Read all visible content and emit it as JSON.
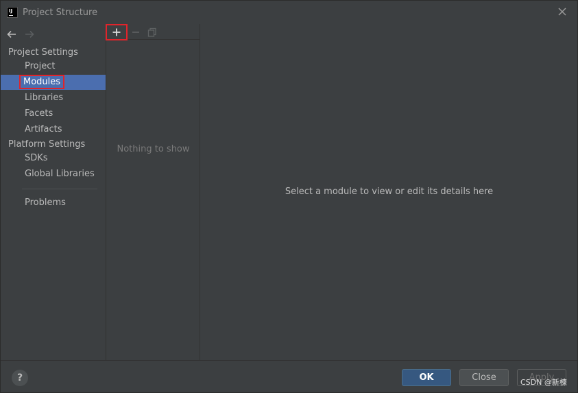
{
  "window": {
    "title": "Project Structure",
    "app_icon_text": "IJ"
  },
  "nav": {
    "back_icon": "arrow-left-icon",
    "forward_icon": "arrow-right-icon",
    "sections": [
      {
        "title": "Project Settings",
        "items": [
          {
            "label": "Project"
          },
          {
            "label": "Modules",
            "selected": true
          },
          {
            "label": "Libraries"
          },
          {
            "label": "Facets"
          },
          {
            "label": "Artifacts"
          }
        ]
      },
      {
        "title": "Platform Settings",
        "items": [
          {
            "label": "SDKs"
          },
          {
            "label": "Global Libraries"
          }
        ]
      }
    ],
    "problems_label": "Problems"
  },
  "module_list": {
    "toolbar": {
      "add_icon": "plus-icon",
      "remove_icon": "minus-icon",
      "copy_icon": "copy-icon"
    },
    "empty_text": "Nothing to show"
  },
  "detail": {
    "hint": "Select a module to view or edit its details here"
  },
  "footer": {
    "help_label": "?",
    "ok_label": "OK",
    "close_label": "Close",
    "apply_label": "Apply",
    "watermark": "CSDN @新楝"
  },
  "colors": {
    "background": "#3c3f41",
    "selection": "#4b6eaf",
    "highlight_box": "#e0242b",
    "ok_button": "#365880"
  }
}
